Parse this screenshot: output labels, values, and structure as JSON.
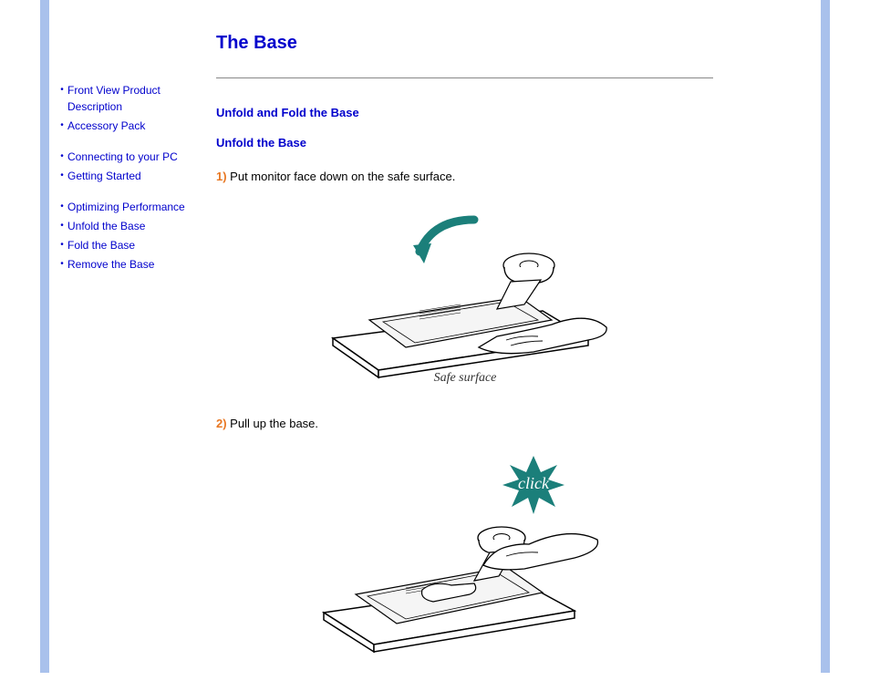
{
  "sidebar": {
    "groups": [
      {
        "items": [
          "Front View Product Description",
          "Accessory Pack"
        ]
      },
      {
        "items": [
          "Connecting to your PC",
          "Getting Started"
        ]
      },
      {
        "items": [
          "Optimizing Performance",
          "Unfold the Base",
          "Fold the Base",
          "Remove the Base"
        ]
      }
    ]
  },
  "page": {
    "title": "The Base",
    "section": "Unfold and Fold the Base",
    "subsection": "Unfold the Base",
    "steps": [
      {
        "num": "1)",
        "text": " Put monitor face down on the safe surface."
      },
      {
        "num": "2)",
        "text": " Pull up the base."
      }
    ],
    "figure1_label": "Safe surface",
    "figure2_label": "click"
  }
}
